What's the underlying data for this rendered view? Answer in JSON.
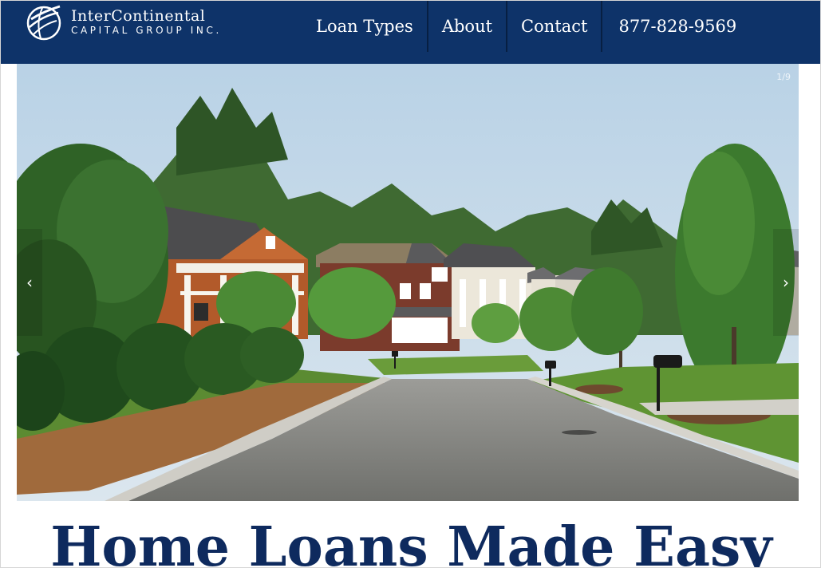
{
  "brand": {
    "name_line1": "InterContinental",
    "name_line2": "CAPITAL GROUP INC.",
    "logo_icon": "globe-swoosh-icon"
  },
  "nav": {
    "items": [
      {
        "label": "Loan Types"
      },
      {
        "label": "About"
      },
      {
        "label": "Contact"
      },
      {
        "label": "877-828-9569"
      }
    ]
  },
  "slideshow": {
    "counter": "1/9",
    "prev_icon": "chevron-left-icon",
    "next_icon": "chevron-right-icon",
    "prev_glyph": "‹",
    "next_glyph": "›",
    "image_alt": "Suburban street lined with houses and trees"
  },
  "hero": {
    "headline": "Home Loans Made Easy"
  },
  "colors": {
    "header_bg": "#0e3369",
    "headline": "#0e2a5e"
  }
}
